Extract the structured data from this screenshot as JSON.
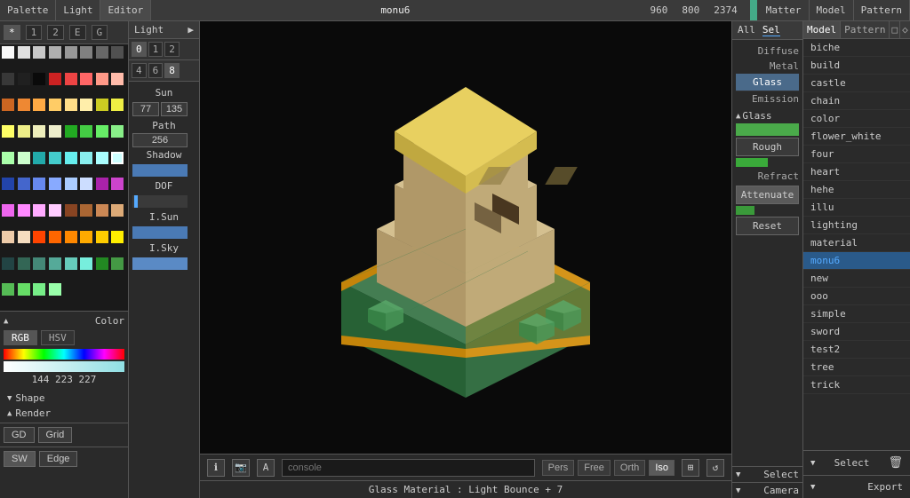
{
  "topbar": {
    "palette_label": "Palette",
    "light_label": "Light",
    "editor_label": "Editor",
    "file_name": "monu6",
    "coord_x": "960",
    "coord_y": "800",
    "coord_z": "2374",
    "matter_label": "Matter",
    "model_label": "Model",
    "pattern_label": "Pattern"
  },
  "palette": {
    "tabs": [
      "*",
      "1",
      "2",
      "E",
      "G"
    ],
    "active_tab": "*",
    "color_sections": {
      "title": "Color",
      "mode_tabs": [
        "RGB",
        "HSV"
      ],
      "active_mode": "RGB",
      "value": "144 223 227"
    }
  },
  "light": {
    "tabs": [
      "0",
      "1",
      "2",
      "4",
      "6",
      "8"
    ],
    "sun_label": "Sun",
    "sun_val1": "77",
    "sun_val2": "135",
    "path_label": "Path",
    "path_val": "256",
    "shadow_label": "Shadow",
    "dof_label": "DOF",
    "isun_label": "I.Sun",
    "isky_label": "I.Sky"
  },
  "matter": {
    "all_tab": "All",
    "sel_tab": "Sel",
    "diffuse_label": "Diffuse",
    "metal_label": "Metal",
    "glass_btn": "Glass",
    "emission_label": "Emission",
    "glass_section_label": "Glass",
    "rough_btn": "Rough",
    "refract_label": "Refract",
    "attenuate_btn": "Attenuate",
    "reset_btn": "Reset"
  },
  "model_list": {
    "model_tab": "Model",
    "pattern_tab": "Pattern",
    "items": [
      "biche",
      "build",
      "castle",
      "chain",
      "color",
      "flower_white",
      "four",
      "heart",
      "hehe",
      "illu",
      "lighting",
      "material",
      "monu6",
      "new",
      "ooo",
      "simple",
      "sword",
      "test2",
      "tree",
      "trick"
    ],
    "active_item": "monu6"
  },
  "right_panel": {
    "select_label": "Select",
    "camera_label": "Camera",
    "export_label": "Export",
    "delete_icon": "🗑"
  },
  "editor": {
    "view_buttons": [
      "Pers",
      "Free",
      "Orth",
      "Iso"
    ],
    "active_view": "Iso",
    "console_placeholder": "console",
    "status_text": "Glass Material : Light Bounce + 7",
    "bottom_icons": [
      "info",
      "camera",
      "A"
    ]
  },
  "bottom_panel": {
    "shape_label": "Shape",
    "render_label": "Render",
    "gd_btn": "GD",
    "grid_btn": "Grid",
    "sw_btn": "SW",
    "edge_btn": "Edge"
  }
}
